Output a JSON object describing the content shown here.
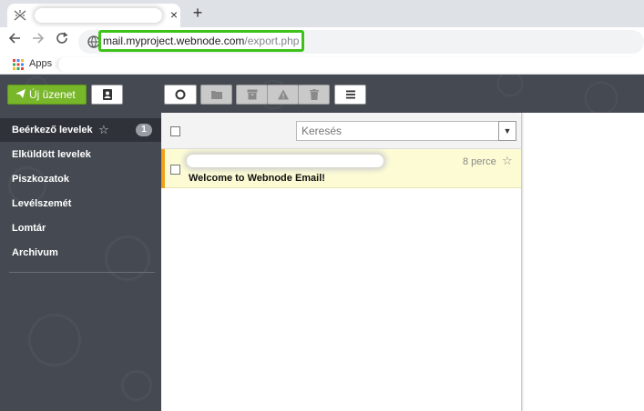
{
  "browser": {
    "new_tab_symbol": "+",
    "tab_close_symbol": "×",
    "url_domain": "mail.myproject.webnode.com",
    "url_path": "/export.php",
    "highlight_color": "#3ec21a",
    "bookmarks": {
      "apps_label": "Apps"
    }
  },
  "toolbar": {
    "new_message_label": "Új üzenet",
    "accent_color": "#78b62a",
    "icons": [
      "contacts-icon",
      "refresh-icon",
      "folder-icon",
      "archive-icon",
      "spam-icon",
      "trash-icon",
      "menu-icon"
    ]
  },
  "sidebar": {
    "folders": [
      {
        "label": "Beérkező levelek",
        "count": "1",
        "active": true
      },
      {
        "label": "Elküldött levelek"
      },
      {
        "label": "Piszkozatok"
      },
      {
        "label": "Levélszemét"
      },
      {
        "label": "Lomtár"
      },
      {
        "label": "Archivum"
      }
    ]
  },
  "list": {
    "search_placeholder": "Keresés",
    "messages": [
      {
        "subject": "Welcome to Webnode Email!",
        "time": "8 perce",
        "unread": true
      }
    ]
  }
}
